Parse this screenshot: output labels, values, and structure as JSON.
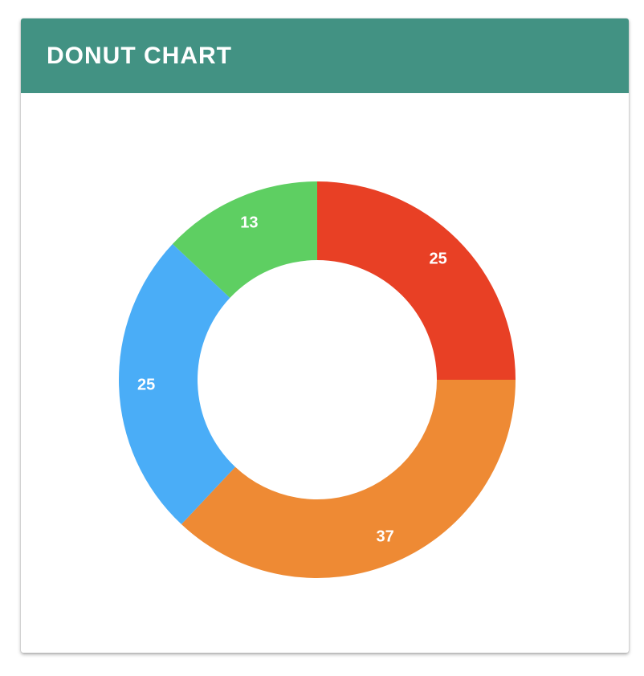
{
  "panel": {
    "title": "DONUT CHART"
  },
  "chart_data": {
    "type": "pie",
    "donut": true,
    "start": "12 o'clock, clockwise",
    "slices": [
      {
        "label": "25",
        "value": 25,
        "color": "#E84025"
      },
      {
        "label": "37",
        "value": 37,
        "color": "#EE8A34"
      },
      {
        "label": "25",
        "value": 25,
        "color": "#4AADF7"
      },
      {
        "label": "13",
        "value": 13,
        "color": "#5ECF62"
      }
    ],
    "legend": "none"
  }
}
